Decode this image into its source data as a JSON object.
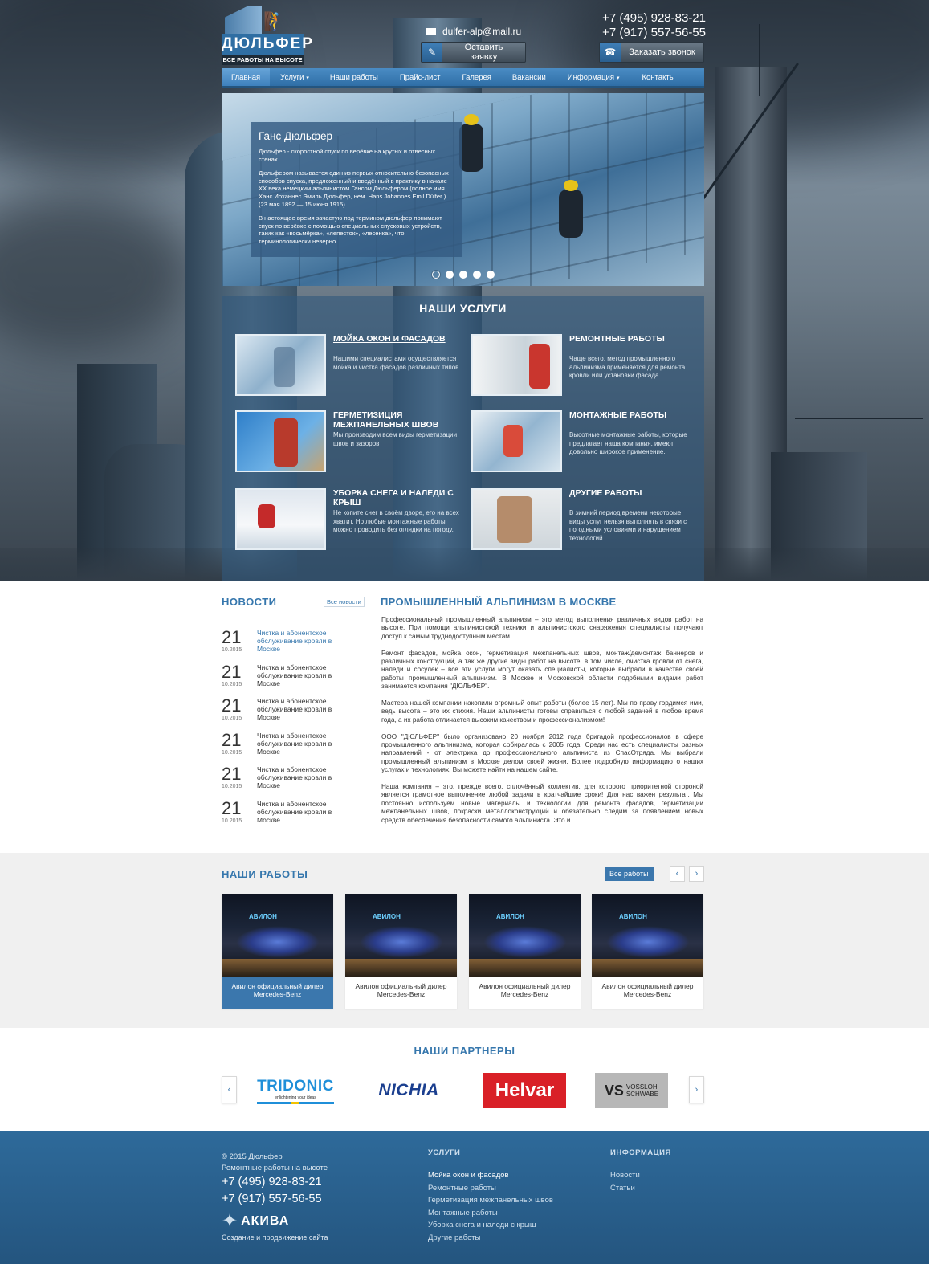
{
  "brand": {
    "logo_name": "ДЮЛЬФЕР",
    "logo_tagline": "ВСЕ РАБОТЫ НА ВЫСОТЕ"
  },
  "header": {
    "email": "dulfer-alp@mail.ru",
    "phone1": "+7 (495) 928-83-21",
    "phone2": "+7 (917) 557-56-55",
    "request_button": "Оставить заявку",
    "call_button": "Заказать звонок"
  },
  "nav": [
    {
      "label": "Главная",
      "active": true
    },
    {
      "label": "Услуги",
      "dropdown": true
    },
    {
      "label": "Наши работы"
    },
    {
      "label": "Прайс-лист"
    },
    {
      "label": "Галерея"
    },
    {
      "label": "Вакансии"
    },
    {
      "label": "Информация",
      "dropdown": true
    },
    {
      "label": "Контакты"
    }
  ],
  "slider": {
    "title": "Ганс Дюльфер",
    "paragraphs": [
      "Дюльфер - скоростной спуск по верёвке на крутых и отвесных стенах.",
      "Дюльфером называется один из первых относительно безопасных способов спуска, предложенный и введённый в практику в начале XX века немецким альпинистом Гансом Дюльфером (полное имя Ханс Иоханнес Эмиль Дюльфер, нем. Hans Johannes Emil Dülfer ) (23 мая 1892 — 15 июня 1915).",
      "В настоящее время зачастую под термином дюльфер понимают спуск по верёвке с помощью специальных спусковых устройств, таких как «восьмёрка», «лепесток», «лесенка», что терминологически неверно."
    ],
    "dots_total": 5,
    "active_dot": 1
  },
  "services": {
    "heading": "НАШИ УСЛУГИ",
    "items": [
      {
        "title": "МОЙКА ОКОН И ФАСАДОВ",
        "desc": "Нашими специалистами осуществляется мойка и чистка фасадов различных типов."
      },
      {
        "title": "РЕМОНТНЫЕ РАБОТЫ",
        "desc": "Чаще всего, метод промышленного альпинизма применяется для ремонта кровли или установки фасада."
      },
      {
        "title": "ГЕРМЕТИЗИЦИЯ МЕЖПАНЕЛЬНЫХ ШВОВ",
        "desc": "Мы производим всем виды герметизации швов и зазоров"
      },
      {
        "title": "МОНТАЖНЫЕ РАБОТЫ",
        "desc": "Высотные монтажные работы, которые предлагает наша компания, имеют довольно широкое применение."
      },
      {
        "title": "УБОРКА СНЕГА И НАЛЕДИ С КРЫШ",
        "desc": "Не копите снег в своём дворе, его на всех хватит.  Но любые монтажные работы можно проводить без оглядки на погоду."
      },
      {
        "title": "ДРУГИЕ РАБОТЫ",
        "desc": "В зимний период времени некоторые виды услуг нельзя выполнять в связи с погодными условиями и нарушением технологий."
      }
    ]
  },
  "news": {
    "heading": "НОВОСТИ",
    "all_link": "Все новости",
    "items": [
      {
        "day": "21",
        "month_year": "10.2015",
        "title": "Чистка и абонентское обслуживание кровли в Москве"
      },
      {
        "day": "21",
        "month_year": "10.2015",
        "title": "Чистка и абонентское обслуживание кровли в Москве"
      },
      {
        "day": "21",
        "month_year": "10.2015",
        "title": "Чистка и абонентское обслуживание кровли в Москве"
      },
      {
        "day": "21",
        "month_year": "10.2015",
        "title": "Чистка и абонентское обслуживание кровли в Москве"
      },
      {
        "day": "21",
        "month_year": "10.2015",
        "title": "Чистка и абонентское обслуживание кровли в Москве"
      },
      {
        "day": "21",
        "month_year": "10.2015",
        "title": "Чистка и абонентское обслуживание кровли в Москве"
      }
    ]
  },
  "about": {
    "heading": "ПРОМЫШЛЕННЫЙ АЛЬПИНИЗМ В МОСКВЕ",
    "paragraphs": [
      "Профессиональный промышленный альпинизм – это метод выполнения различных видов работ на высоте. При помощи альпинистской техники и альпинистского снаряжения специалисты получают доступ к самым труднодоступным местам.",
      "Ремонт фасадов, мойка окон, герметизация межпанельных швов, монтаж/демонтаж баннеров и различных конструкций, а так же другие виды работ на высоте, в том числе, очистка кровли от снега, наледи и сосулек – все эти услуги могут оказать специалисты, которые выбрали в качестве своей работы промышленный альпинизм. В Москве и Московской области подобными видами работ занимается компания \"ДЮЛЬФЕР\".",
      "Мастера нашей компании накопили огромный опыт работы (более 15 лет). Мы по праву гордимся ими, ведь высота – это их стихия. Наши альпинисты готовы справиться с любой задачей в любое время года, а их работа отличается высоким качеством и профессионализмом!",
      "ООО \"ДЮЛЬФЕР\" было организовано 20 ноября 2012 года бригадой профессионалов в сфере промышленного альпинизма, которая собиралась с 2005 года. Среди нас есть специалисты разных направлений - от электрика до профессионального альпиниста из СпасОтряда. Мы выбрали промышленный альпинизм в Москве делом своей жизни. Более подробную информацию о наших услугах и технологиях, Вы можете найти на нашем сайте.",
      "Наша компания – это, прежде всего, сплочённый коллектив, для которого приоритетной стороной является грамотное выполнение любой задачи в кратчайшие сроки! Для нас важен результат. Мы постоянно используем новые материалы и технологии для ремонта фасадов, герметизации межпанельных швов, покраски металлоконструкций и обязательно следим за появлением новых средств обеспечения безопасности самого альпиниста. Это и"
    ]
  },
  "works": {
    "heading": "НАШИ РАБОТЫ",
    "all_button": "Все работы",
    "prev": "‹",
    "next": "›",
    "items": [
      {
        "image_label": "АВИЛОН",
        "caption": "Авилон официальный дилер Mercedes-Benz",
        "active": true
      },
      {
        "image_label": "АВИЛОН",
        "caption": "Авилон официальный дилер Mercedes-Benz"
      },
      {
        "image_label": "АВИЛОН",
        "caption": "Авилон официальный дилер Mercedes-Benz"
      },
      {
        "image_label": "АВИЛОН",
        "caption": "Авилон официальный дилер Mercedes-Benz"
      }
    ]
  },
  "partners": {
    "heading": "НАШИ ПАРТНЕРЫ",
    "prev": "‹",
    "next": "›",
    "tridonic": {
      "name": "TRIDONIC",
      "slogan": "enlightening your ideas"
    },
    "nichia": {
      "name": "NICHIA"
    },
    "helvar": {
      "name": "Helvar"
    },
    "vossloh": {
      "mark": "VS",
      "line1": "VOSSLOH",
      "line2": "SCHWABE"
    }
  },
  "footer": {
    "copyright": "© 2015  Дюльфер",
    "tagline": "Ремонтные работы на высоте",
    "phone1": "+7 (495) 928-83-21",
    "phone2": "+7 (917) 557-56-55",
    "agency": "АКИВА",
    "agency_sub": "Создание и продвижение сайта",
    "services_heading": "УСЛУГИ",
    "services_links": [
      "Мойка окон и фасадов",
      "Ремонтные работы",
      "Герметизация межпанельных швов",
      "Монтажные работы",
      "Уборка снега и наледи с крыш",
      "Другие работы"
    ],
    "info_heading": "ИНФОРМАЦИЯ",
    "info_links": [
      "Новости",
      "Статьи"
    ]
  },
  "colors": {
    "brand_blue": "#3677ad",
    "nav_blue": "#2f6ea6",
    "footer_blue": "#2e6a9a",
    "helvar_red": "#d92027"
  }
}
